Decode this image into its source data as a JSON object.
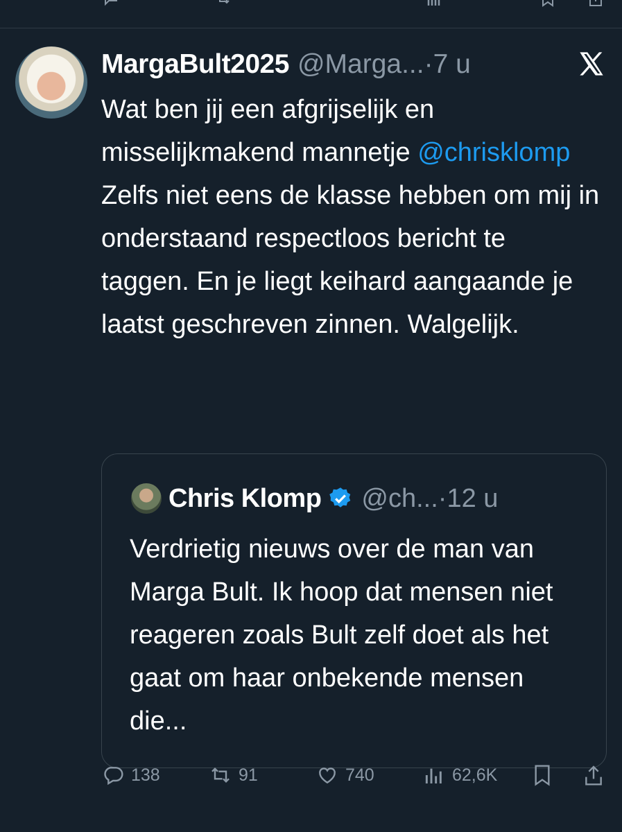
{
  "tweet": {
    "display_name": "MargaBult2025",
    "handle": "@Marga...",
    "time": "·7 u",
    "text_before": "Wat ben jij een afgrijselijk en misselijkmakend mannetje ",
    "mention": "@chrisklomp",
    "text_after": " Zelfs niet eens de klasse hebben om mij in onderstaand respectloos bericht te taggen. En je liegt keihard aangaande je laatst geschreven zinnen. Walgelijk."
  },
  "quote": {
    "display_name": "Chris Klomp",
    "handle": "@ch...",
    "time": "·12 u",
    "text": "Verdrietig nieuws over de man van Marga Bult. Ik hoop dat mensen niet reageren zoals Bult zelf doet als het gaat om haar onbekende mensen die..."
  },
  "actions": {
    "replies": "138",
    "retweets": "91",
    "likes": "740",
    "views": "62,6K"
  },
  "colors": {
    "background": "#15202b",
    "accent": "#1d9bf0",
    "muted": "#8b98a5",
    "border": "#38444d"
  },
  "icons": [
    "reply-icon",
    "retweet-icon",
    "like-icon",
    "views-icon",
    "bookmark-icon",
    "share-icon",
    "x-logo-icon",
    "verified-badge-icon"
  ]
}
